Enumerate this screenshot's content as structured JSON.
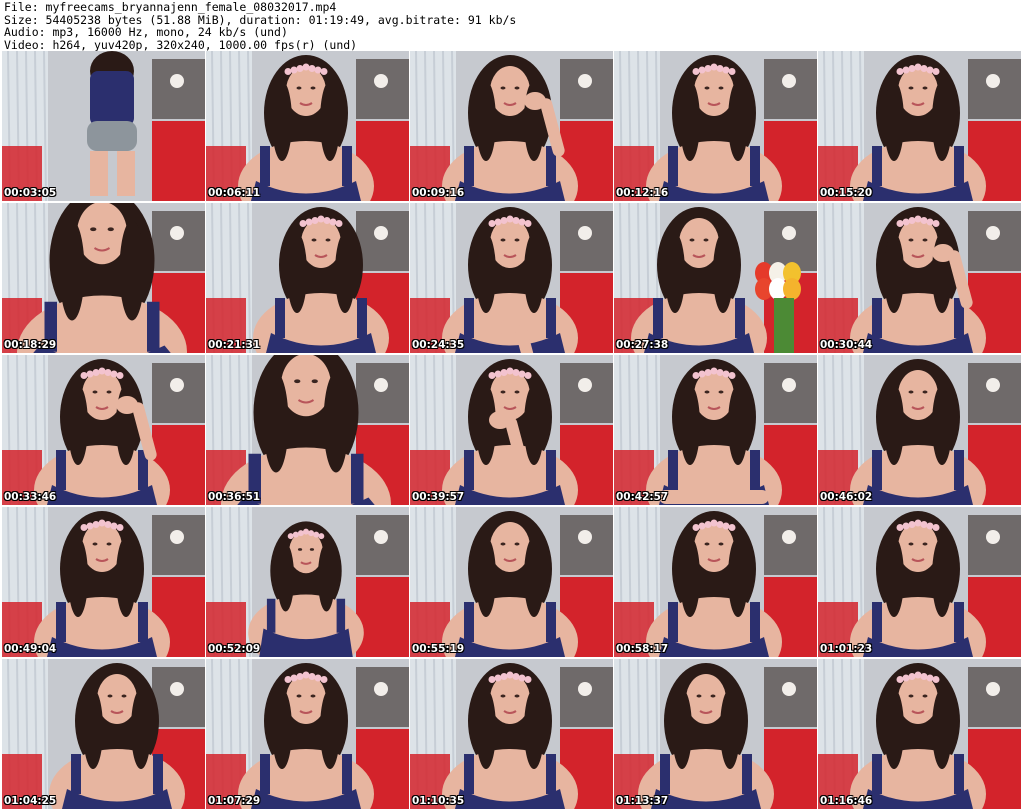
{
  "header": {
    "file": "File: myfreecams_bryannajenn_female_08032017.mp4",
    "size": "Size: 54405238 bytes (51.88 MiB), duration: 01:19:49, avg.bitrate: 91 kb/s",
    "audio": "Audio: mp3, 16000 Hz, mono, 24 kb/s (und)",
    "video": "Video: h264, yuv420p, 320x240, 1000.00 fps(r) (und)"
  },
  "thumbnails": [
    {
      "timestamp": "00:03:05",
      "shot": "back"
    },
    {
      "timestamp": "00:06:11",
      "shot": "tilt"
    },
    {
      "timestamp": "00:09:16",
      "shot": "hand-hair"
    },
    {
      "timestamp": "00:12:16",
      "shot": "center"
    },
    {
      "timestamp": "00:15:20",
      "shot": "center"
    },
    {
      "timestamp": "00:18:29",
      "shot": "close"
    },
    {
      "timestamp": "00:21:31",
      "shot": "side"
    },
    {
      "timestamp": "00:24:35",
      "shot": "hand-chest"
    },
    {
      "timestamp": "00:27:38",
      "shot": "flowers"
    },
    {
      "timestamp": "00:30:44",
      "shot": "hand-hair"
    },
    {
      "timestamp": "00:33:46",
      "shot": "hand-face"
    },
    {
      "timestamp": "00:36:51",
      "shot": "close"
    },
    {
      "timestamp": "00:39:57",
      "shot": "hand-chin"
    },
    {
      "timestamp": "00:42:57",
      "shot": "arms"
    },
    {
      "timestamp": "00:46:02",
      "shot": "center"
    },
    {
      "timestamp": "00:49:04",
      "shot": "center"
    },
    {
      "timestamp": "00:52:09",
      "shot": "wide"
    },
    {
      "timestamp": "00:55:19",
      "shot": "center"
    },
    {
      "timestamp": "00:58:17",
      "shot": "center"
    },
    {
      "timestamp": "01:01:23",
      "shot": "center"
    },
    {
      "timestamp": "01:04:25",
      "shot": "side"
    },
    {
      "timestamp": "01:07:29",
      "shot": "center"
    },
    {
      "timestamp": "01:10:35",
      "shot": "center"
    },
    {
      "timestamp": "01:13:37",
      "shot": "lean"
    },
    {
      "timestamp": "01:16:46",
      "shot": "center"
    }
  ],
  "colors": {
    "wall": "#c6c9cf",
    "curtain": "#dde3e8",
    "sofa": "#d3232b",
    "top": "#2b2f6e",
    "hair": "#2a1a16",
    "skin": "#e7b5a0",
    "flower": "#f3c3cf"
  }
}
